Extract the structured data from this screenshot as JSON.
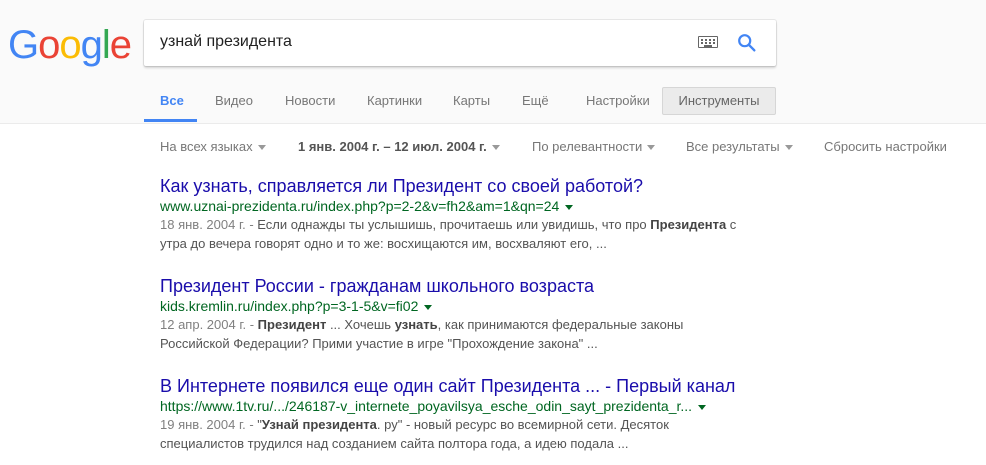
{
  "logo": {
    "letters": [
      {
        "char": "G",
        "color": "#4285f4"
      },
      {
        "char": "o",
        "color": "#ea4335"
      },
      {
        "char": "o",
        "color": "#fbbc05"
      },
      {
        "char": "g",
        "color": "#4285f4"
      },
      {
        "char": "l",
        "color": "#34a853"
      },
      {
        "char": "e",
        "color": "#ea4335"
      }
    ]
  },
  "search": {
    "query": "узнай президента",
    "keyboard_icon": "keyboard-icon",
    "search_icon": "magnifier-icon"
  },
  "tabs": [
    {
      "label": "Все",
      "active": true
    },
    {
      "label": "Видео"
    },
    {
      "label": "Новости"
    },
    {
      "label": "Картинки"
    },
    {
      "label": "Карты"
    },
    {
      "label": "Ещё"
    },
    {
      "label": "Настройки"
    }
  ],
  "tools_label": "Инструменты",
  "filters": {
    "language": "На всех языках",
    "date_range": "1 янв. 2004 г. – 12 июл. 2004 г.",
    "sort": "По релевантности",
    "results": "Все результаты",
    "reset": "Сбросить настройки"
  },
  "results": [
    {
      "title": "Как узнать, справляется ли Президент со своей работой?",
      "url": "www.uznai-prezidenta.ru/index.php?p=2-2&v=fh2&am=1&qn=24",
      "date": "18 янв. 2004 г. - ",
      "snippet_parts": [
        {
          "text": "Если однажды ты услышишь, прочитаешь или увидишь, что про "
        },
        {
          "text": "Президента",
          "bold": true
        },
        {
          "text": " с утра до вечера говорят одно и то же: восхищаются им, восхваляют его, ..."
        }
      ]
    },
    {
      "title": "Президент России - гражданам школьного возраста",
      "url": "kids.kremlin.ru/index.php?p=3-1-5&v=fi02",
      "date": "12 апр. 2004 г. - ",
      "snippet_parts": [
        {
          "text": "Президент",
          "bold": true
        },
        {
          "text": " ... Хочешь "
        },
        {
          "text": "узнать",
          "bold": true
        },
        {
          "text": ", как принимаются федеральные законы Российской Федерации? Прими участие в игре \"Прохождение закона\" ..."
        }
      ]
    },
    {
      "title": "В Интернете появился еще один сайт Президента ... - Первый канал",
      "url": "https://www.1tv.ru/.../246187-v_internete_poyavilsya_esche_odin_sayt_prezidenta_r...",
      "date": "19 янв. 2004 г. - ",
      "snippet_parts": [
        {
          "text": "\""
        },
        {
          "text": "Узнай президента",
          "bold": true
        },
        {
          "text": ". ру\" - новый ресурс во всемирной сети. Десяток специалистов трудился над созданием сайта полтора года, а идею подала ..."
        }
      ]
    }
  ]
}
